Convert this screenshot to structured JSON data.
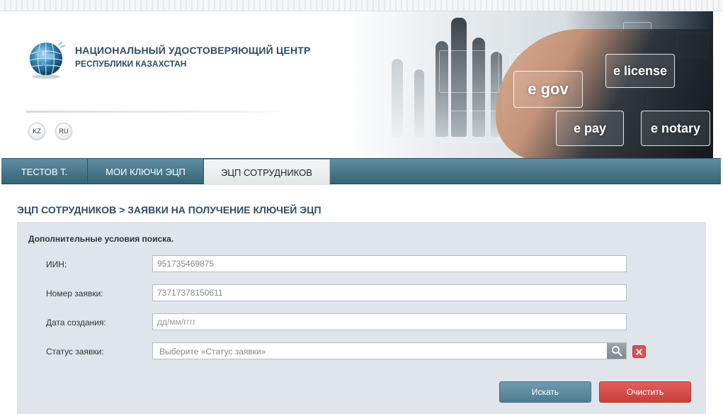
{
  "header": {
    "org_name": "НАЦИОНАЛЬНЫЙ УДОСТОВЕРЯЮЩИЙ ЦЕНТР",
    "org_sub": "РЕСПУБЛИКИ КАЗАХСТАН",
    "languages": [
      "KZ",
      "RU"
    ],
    "banner_labels": [
      "e gov",
      "e license",
      "e pay",
      "e notary"
    ]
  },
  "nav": {
    "items": [
      {
        "label": "ТЕСТОВ Т.",
        "active": false
      },
      {
        "label": "МОИ КЛЮЧИ ЭЦП",
        "active": false
      },
      {
        "label": "ЭЦП СОТРУДНИКОВ",
        "active": true
      }
    ]
  },
  "page": {
    "title": "ЭЦП СОТРУДНИКОВ > ЗАЯВКИ НА ПОЛУЧЕНИЕ КЛЮЧЕЙ ЭЦП"
  },
  "search": {
    "panel_title": "Дополнительные условия поиска.",
    "iin": {
      "label": "ИИН:",
      "value": "951735469875"
    },
    "request_number": {
      "label": "Номер заявки:",
      "value": "73717378150611"
    },
    "created_date": {
      "label": "Дата создания:",
      "placeholder": "дд/мм/гггг"
    },
    "status": {
      "label": "Статус заявки:",
      "placeholder": "Выберите «Статус заявки»"
    },
    "search_button": "Искать",
    "clear_button": "Очистить"
  },
  "colors": {
    "nav_bg": "#4a7a8e",
    "title": "#2f4f63",
    "panel_bg": "#dfe5ea",
    "search_button": "#5b8aa0",
    "clear_button": "#d44d48"
  },
  "icons": {
    "logo": "globe-logo-icon",
    "select_search": "search-icon",
    "status_clear": "close-icon"
  }
}
